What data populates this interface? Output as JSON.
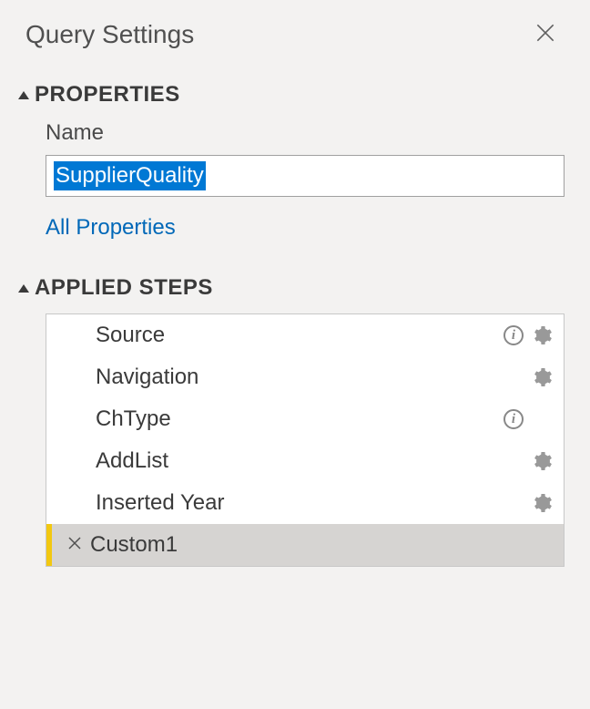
{
  "header": {
    "title": "Query Settings"
  },
  "properties": {
    "section_title": "PROPERTIES",
    "name_label": "Name",
    "name_value": "SupplierQuality",
    "all_properties_link": "All Properties"
  },
  "applied_steps": {
    "section_title": "APPLIED STEPS",
    "steps": [
      {
        "label": "Source",
        "has_info": true,
        "has_gear": true,
        "selected": false
      },
      {
        "label": "Navigation",
        "has_info": false,
        "has_gear": true,
        "selected": false
      },
      {
        "label": "ChType",
        "has_info": true,
        "has_gear": false,
        "selected": false
      },
      {
        "label": "AddList",
        "has_info": false,
        "has_gear": true,
        "selected": false
      },
      {
        "label": "Inserted Year",
        "has_info": false,
        "has_gear": true,
        "selected": false
      },
      {
        "label": "Custom1",
        "has_info": false,
        "has_gear": false,
        "selected": true
      }
    ]
  }
}
